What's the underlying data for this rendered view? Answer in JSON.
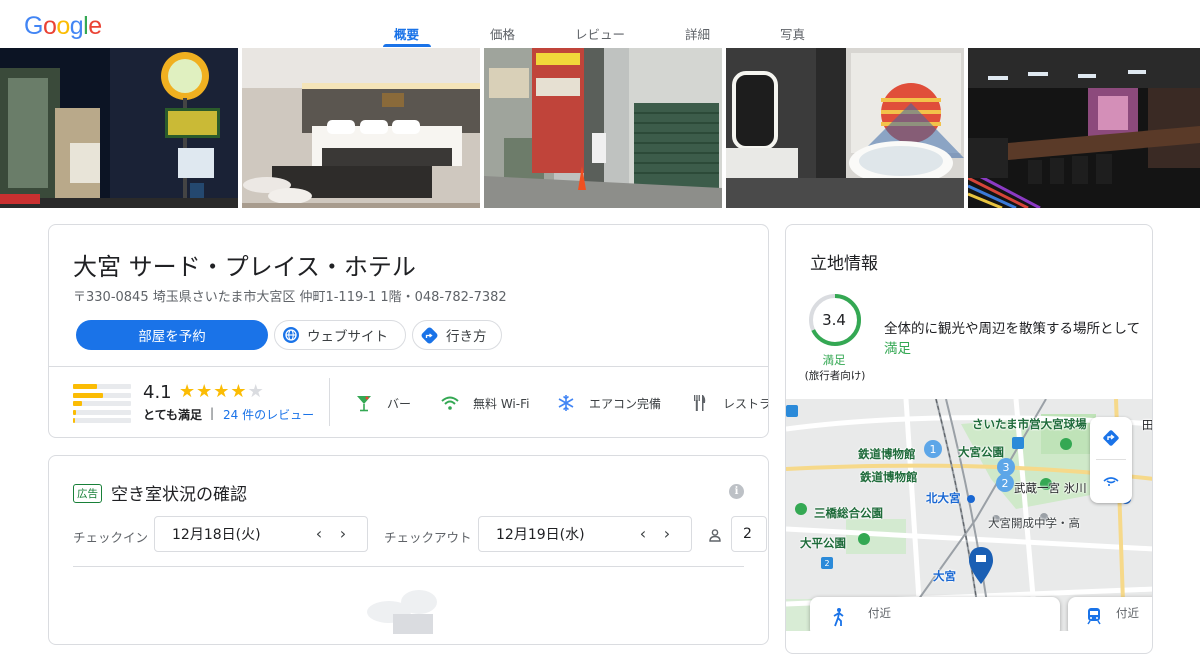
{
  "brand": {
    "logo": "Google",
    "logo_letters": [
      {
        "ch": "G",
        "color": "#4285f4"
      },
      {
        "ch": "o",
        "color": "#ea4335"
      },
      {
        "ch": "o",
        "color": "#fbbc04"
      },
      {
        "ch": "g",
        "color": "#4285f4"
      },
      {
        "ch": "l",
        "color": "#34a853"
      },
      {
        "ch": "e",
        "color": "#ea4335"
      }
    ]
  },
  "tabs": [
    {
      "label": "概要",
      "active": true
    },
    {
      "label": "価格",
      "active": false
    },
    {
      "label": "レビュー",
      "active": false
    },
    {
      "label": "詳細",
      "active": false
    },
    {
      "label": "写真",
      "active": false
    }
  ],
  "hotel": {
    "name": "大宮 サード・プレイス・ホテル",
    "address": "〒330-0845 埼玉県さいたま市大宮区 仲町1-119-1 1階・048-782-7382",
    "actions": {
      "book": "部屋を予約",
      "website": "ウェブサイト",
      "directions": "行き方"
    }
  },
  "rating": {
    "score": "4.1",
    "stars_value": 4.1,
    "label": "とても満足",
    "separator": "|",
    "reviews": "24 件のレビュー",
    "distribution": [
      0.42,
      0.52,
      0.15,
      0.05,
      0.03
    ]
  },
  "amenities": [
    {
      "icon": "cocktail-icon",
      "label": "バー"
    },
    {
      "icon": "wifi-icon",
      "label": "無料 Wi-Fi"
    },
    {
      "icon": "snowflake-icon",
      "label": "エアコン完備"
    },
    {
      "icon": "restaurant-icon",
      "label": "レストラ"
    }
  ],
  "availability": {
    "ad_badge": "広告",
    "title": "空き室状況の確認",
    "checkin_label": "チェックイン",
    "checkin_value": "12月18日(火)",
    "checkout_label": "チェックアウト",
    "checkout_value": "12月19日(水)",
    "guests": "2"
  },
  "location": {
    "title": "立地情報",
    "score": "3.4",
    "score_fraction": 0.68,
    "score_label": "満足",
    "score_sub": "(旅行者向け)",
    "description": "全体的に観光や周辺を散策する場所として",
    "level": "満足",
    "map_labels": {
      "museum1": "鉄道博物館",
      "museum2": "鉄道博物館",
      "park_omiya": "大宮公園",
      "stadium": "さいたま市営大宮球場",
      "kitaomiya": "北大宮",
      "shrine": "武蔵一宮 氷川",
      "park_sanbashi": "三橋総合公園",
      "school": "大宮開成中学・高",
      "park_ohira": "大平公園",
      "omiya": "大宮",
      "corner": "田"
    },
    "nearby": [
      {
        "label": "付近",
        "icon": "walk-icon"
      },
      {
        "label": "付近",
        "icon": "train-icon"
      }
    ]
  }
}
